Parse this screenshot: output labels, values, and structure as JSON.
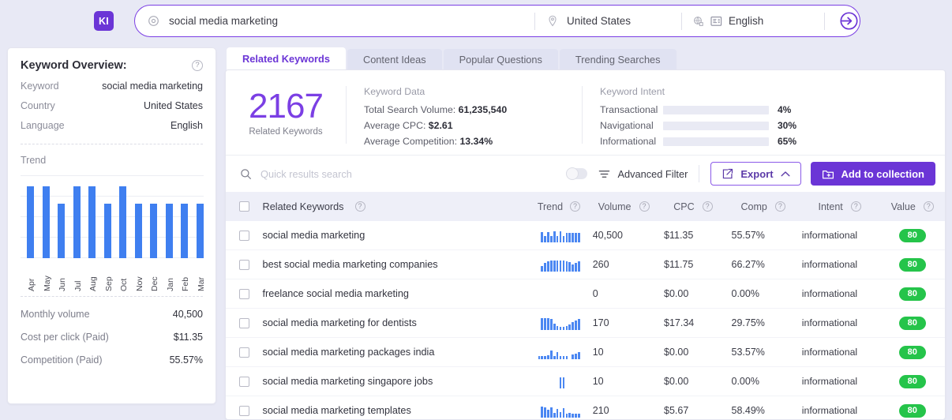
{
  "brand": {
    "logo_text": "KI",
    "accent": "#6b35d6"
  },
  "search": {
    "keyword_value": "social media marketing",
    "keyword_icon": "target-icon",
    "country_value": "United States",
    "country_icon": "location-pin-icon",
    "language_value": "English",
    "language_icons": [
      "globe-icon",
      "translate-icon"
    ],
    "submit_icon": "arrow-into-circle-icon"
  },
  "overview": {
    "title": "Keyword Overview:",
    "help_icon": "question-mark-icon",
    "rows": [
      {
        "label": "Keyword",
        "value": "social media marketing"
      },
      {
        "label": "Country",
        "value": "United States"
      },
      {
        "label": "Language",
        "value": "English"
      }
    ],
    "trend_label": "Trend",
    "stats": [
      {
        "label": "Monthly volume",
        "value": "40,500"
      },
      {
        "label": "Cost per click (Paid)",
        "value": "$11.35"
      },
      {
        "label": "Competition (Paid)",
        "value": "55.57%"
      }
    ]
  },
  "chart_data": {
    "type": "bar",
    "title": "Trend",
    "categories": [
      "Apr",
      "May",
      "Jun",
      "Jul",
      "Aug",
      "Sep",
      "Oct",
      "Nov",
      "Dec",
      "Jan",
      "Feb",
      "Mar"
    ],
    "values": [
      100,
      100,
      76,
      100,
      100,
      76,
      100,
      76,
      76,
      76,
      76,
      76
    ],
    "xlabel": "",
    "ylabel": "",
    "ylim": [
      0,
      115
    ],
    "grid": true,
    "bar_color": "#3f7ff0"
  },
  "tabs": [
    {
      "label": "Related Keywords",
      "active": true
    },
    {
      "label": "Content Ideas",
      "active": false
    },
    {
      "label": "Popular Questions",
      "active": false
    },
    {
      "label": "Trending Searches",
      "active": false
    }
  ],
  "summary": {
    "count": "2167",
    "count_caption": "Related Keywords",
    "keyword_data_title": "Keyword Data",
    "keyword_data": [
      {
        "label": "Total Search Volume:",
        "value": "61,235,540"
      },
      {
        "label": "Average CPC:",
        "value": "$2.61"
      },
      {
        "label": "Average Competition:",
        "value": "13.34%"
      }
    ],
    "intent_title": "Keyword Intent",
    "intent": [
      {
        "label": "Transactional",
        "pct": "4%",
        "fill": 4,
        "color": "#e03b2f"
      },
      {
        "label": "Navigational",
        "pct": "30%",
        "fill": 30,
        "color": "#f5ab10"
      },
      {
        "label": "Informational",
        "pct": "65%",
        "fill": 65,
        "color": "#2bc745"
      }
    ]
  },
  "toolbar": {
    "search_placeholder": "Quick results search",
    "search_icon": "magnifier-icon",
    "toggle_on": false,
    "filter_icon": "filter-lines-icon",
    "filter_label": "Advanced Filter",
    "export_label": "Export",
    "export_icon": "share-box-icon",
    "export_chevron_icon": "chevron-up-icon",
    "add_label": "Add to collection",
    "add_icon": "folder-plus-icon"
  },
  "table": {
    "headers": {
      "keyword": "Related Keywords",
      "trend": "Trend",
      "volume": "Volume",
      "cpc": "CPC",
      "comp": "Comp",
      "intent": "Intent",
      "value": "Value"
    },
    "rows": [
      {
        "keyword": "social media marketing",
        "volume": "40,500",
        "cpc": "$11.35",
        "comp": "55.57%",
        "intent": "informational",
        "value": "80",
        "spark": [
          13,
          8,
          13,
          8,
          14,
          8,
          14,
          8,
          12,
          12,
          12,
          12,
          12
        ]
      },
      {
        "keyword": "best social media marketing companies",
        "volume": "260",
        "cpc": "$11.75",
        "comp": "66.27%",
        "intent": "informational",
        "value": "80",
        "spark": [
          7,
          11,
          13,
          14,
          14,
          14,
          14,
          14,
          13,
          12,
          9,
          11,
          13
        ]
      },
      {
        "keyword": "freelance social media marketing",
        "volume": "0",
        "cpc": "$0.00",
        "comp": "0.00%",
        "intent": "informational",
        "value": "80",
        "spark": []
      },
      {
        "keyword": "social media marketing for dentists",
        "volume": "170",
        "cpc": "$17.34",
        "comp": "29.75%",
        "intent": "informational",
        "value": "80",
        "spark": [
          15,
          15,
          15,
          14,
          8,
          5,
          4,
          4,
          5,
          7,
          10,
          12,
          14
        ]
      },
      {
        "keyword": "social media marketing packages india",
        "volume": "10",
        "cpc": "$0.00",
        "comp": "53.57%",
        "intent": "informational",
        "value": "80",
        "spark": [
          4,
          4,
          4,
          5,
          11,
          4,
          9,
          4,
          4,
          4,
          0,
          6,
          7,
          9
        ]
      },
      {
        "keyword": "social media marketing singapore jobs",
        "volume": "10",
        "cpc": "$0.00",
        "comp": "0.00%",
        "intent": "informational",
        "value": "80",
        "spark": [
          0,
          0,
          0,
          0,
          0,
          0,
          14,
          14,
          0,
          0,
          0,
          0,
          0
        ]
      },
      {
        "keyword": "social media marketing templates",
        "volume": "210",
        "cpc": "$5.67",
        "comp": "58.49%",
        "intent": "informational",
        "value": "80",
        "spark": [
          14,
          13,
          10,
          13,
          6,
          11,
          7,
          12,
          5,
          6,
          5,
          5,
          5
        ]
      }
    ]
  }
}
